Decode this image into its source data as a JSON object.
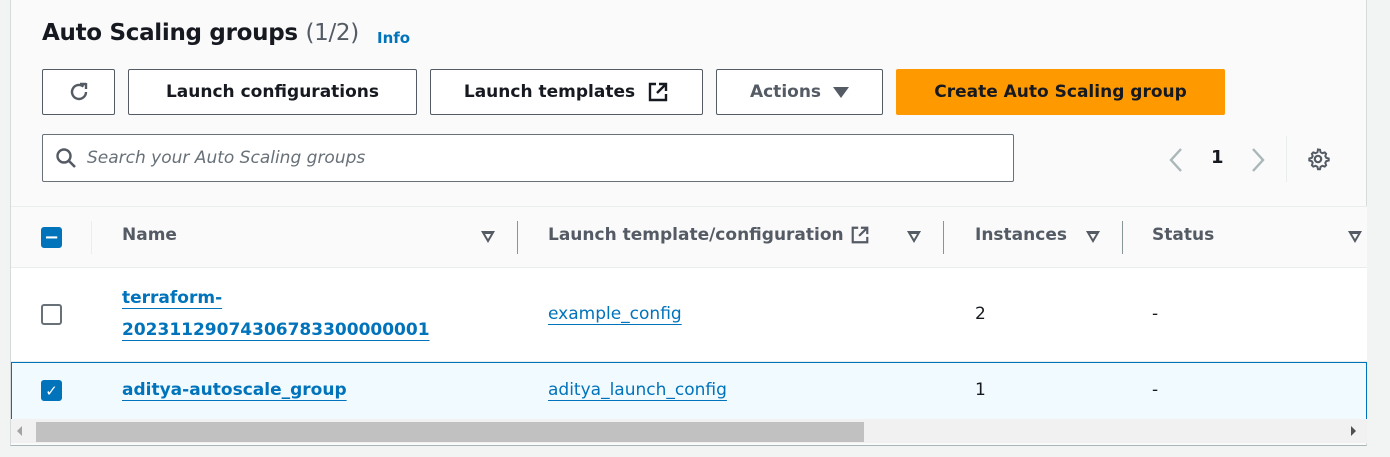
{
  "header": {
    "title": "Auto Scaling groups",
    "count": "(1/2)",
    "info": "Info"
  },
  "toolbar": {
    "launch_configurations": "Launch configurations",
    "launch_templates": "Launch templates",
    "actions": "Actions",
    "create": "Create Auto Scaling group"
  },
  "search": {
    "placeholder": "Search your Auto Scaling groups",
    "value": ""
  },
  "pagination": {
    "page": "1"
  },
  "table": {
    "columns": [
      "Name",
      "Launch template/configuration",
      "Instances",
      "Status"
    ],
    "rows": [
      {
        "name_line1": "terraform-",
        "name_line2": "20231129074306783300000001",
        "config": "example_config",
        "instances": "2",
        "status": "-",
        "selected": false
      },
      {
        "name": "aditya-autoscale_group",
        "config": "aditya_launch_config",
        "instances": "1",
        "status": "-",
        "selected": true
      }
    ]
  },
  "colors": {
    "accent": "#0073bb",
    "primary": "#ff9900"
  }
}
